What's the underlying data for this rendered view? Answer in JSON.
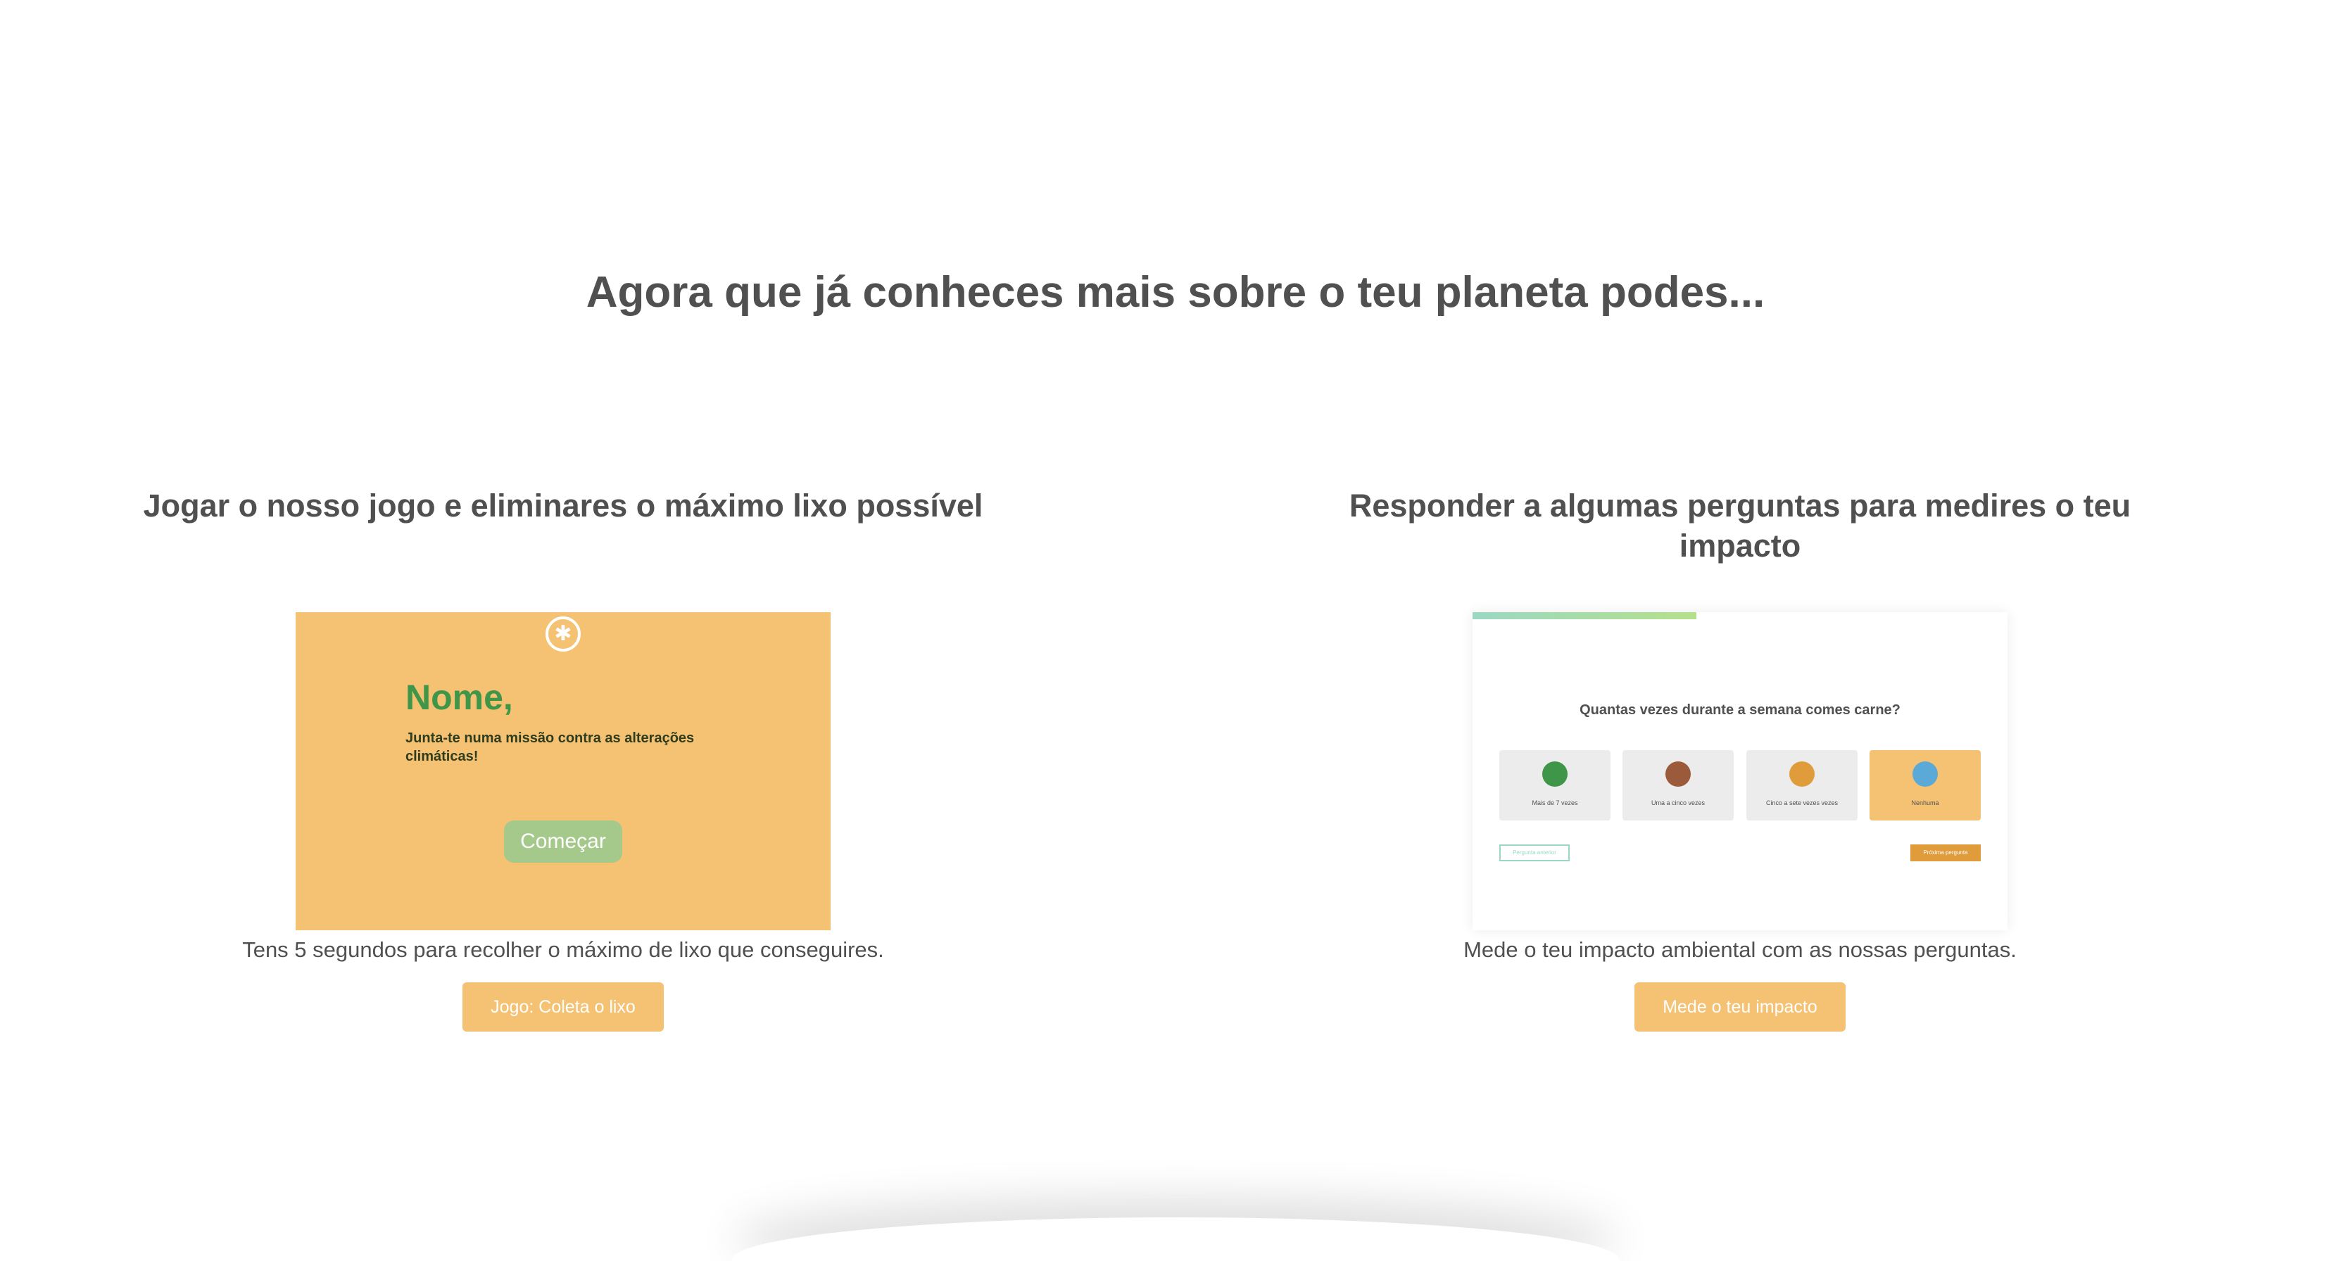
{
  "heading": "Agora que já conheces mais sobre o teu planeta podes...",
  "game_card": {
    "title": "Jogar o nosso jogo e eliminares o máximo lixo possível",
    "preview": {
      "logo_icon": "leaf-logo-icon",
      "name": "Nome,",
      "text": "Junta-te numa missão contra as alterações climáticas!",
      "start_label": "Começar"
    },
    "description": "Tens 5 segundos para recolher o máximo de lixo que conseguires.",
    "button_label": "Jogo: Coleta o lixo"
  },
  "quiz_card": {
    "title": "Responder a algumas perguntas para medires o teu impacto",
    "preview": {
      "question": "Quantas vezes durante a semana comes carne?",
      "options": [
        {
          "label": "Mais de 7 vezes",
          "icon": "meat-icon",
          "icon_color": "#3f9548",
          "selected": false
        },
        {
          "label": "Uma a cinco vezes",
          "icon": "steak-icon",
          "icon_color": "#9b5a3a",
          "selected": false
        },
        {
          "label": "Cinco a sete vezes vezes",
          "icon": "burger-icon",
          "icon_color": "#e09b3a",
          "selected": false
        },
        {
          "label": "Nenhuma",
          "icon": "salad-icon",
          "icon_color": "#5aa9d6",
          "selected": true
        }
      ],
      "prev_label": "Pergunta anterior",
      "next_label": "Próxima pergunta"
    },
    "description": "Mede o teu impacto ambiental com as nossas perguntas.",
    "button_label": "Mede o teu impacto"
  },
  "colors": {
    "accent": "#f4c272",
    "green": "#3f9548",
    "text": "#505050"
  }
}
